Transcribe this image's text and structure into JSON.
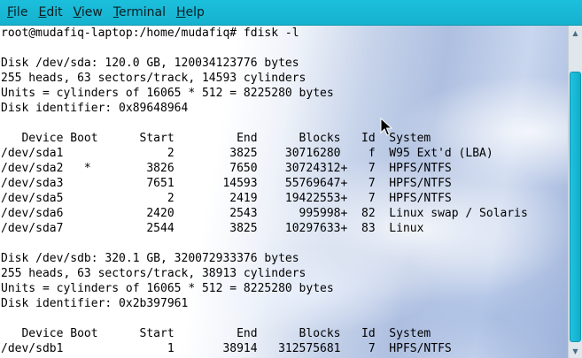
{
  "menubar": {
    "items": [
      {
        "mnemonic": "F",
        "rest": "ile"
      },
      {
        "mnemonic": "E",
        "rest": "dit"
      },
      {
        "mnemonic": "V",
        "rest": "iew"
      },
      {
        "mnemonic": "T",
        "rest": "erminal"
      },
      {
        "mnemonic": "H",
        "rest": "elp"
      }
    ]
  },
  "terminal": {
    "lines": [
      "root@mudafiq-laptop:/home/mudafiq# fdisk -l",
      "",
      "Disk /dev/sda: 120.0 GB, 120034123776 bytes",
      "255 heads, 63 sectors/track, 14593 cylinders",
      "Units = cylinders of 16065 * 512 = 8225280 bytes",
      "Disk identifier: 0x89648964",
      "",
      "   Device Boot      Start         End      Blocks   Id  System",
      "/dev/sda1               2        3825    30716280    f  W95 Ext'd (LBA)",
      "/dev/sda2   *        3826        7650    30724312+   7  HPFS/NTFS",
      "/dev/sda3            7651       14593    55769647+   7  HPFS/NTFS",
      "/dev/sda5               2        2419    19422553+   7  HPFS/NTFS",
      "/dev/sda6            2420        2543      995998+  82  Linux swap / Solaris",
      "/dev/sda7            2544        3825    10297633+  83  Linux",
      "",
      "Disk /dev/sdb: 320.1 GB, 320072933376 bytes",
      "255 heads, 63 sectors/track, 38913 cylinders",
      "Units = cylinders of 16065 * 512 = 8225280 bytes",
      "Disk identifier: 0x2b397961",
      "",
      "   Device Boot      Start         End      Blocks   Id  System",
      "/dev/sdb1               1       38914   312575681    7  HPFS/NTFS"
    ]
  },
  "scrollbar": {
    "up_arrow": "▲",
    "down_arrow": "▼",
    "position_fraction": 0.86
  },
  "icons": {
    "pointer": "mouse-pointer-icon"
  },
  "colors": {
    "menubar_bg": "#16b2cf",
    "scroll_thumb": "#13acca",
    "text": "#000000"
  }
}
